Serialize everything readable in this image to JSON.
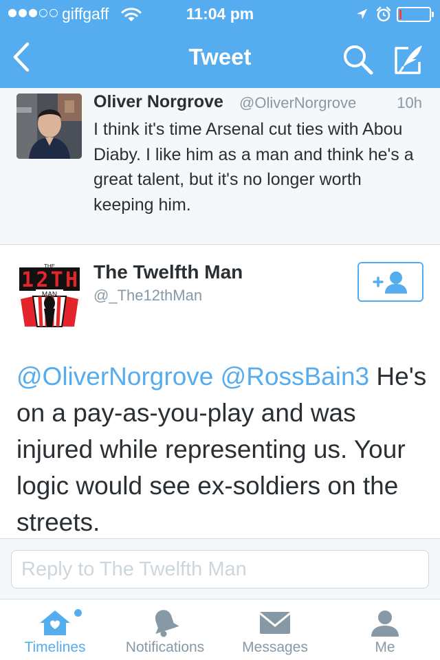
{
  "status_bar": {
    "carrier": "giffgaff",
    "signal_bars_filled": 3,
    "signal_bars_total": 5,
    "time": "11:04 pm",
    "battery_level_fraction": 0.08,
    "battery_color": "#ff3b30"
  },
  "nav": {
    "title": "Tweet",
    "back_icon": "chevron-left-icon",
    "search_icon": "search-icon",
    "compose_icon": "compose-quill-icon",
    "color": "#55acee"
  },
  "parent_tweet": {
    "name": "Oliver Norgrove",
    "handle": "@OliverNorgrove",
    "time": "10h",
    "text": "I think it's time Arsenal cut ties with Abou Diaby. I like him as a man and think he's a great talent, but it's no longer worth keeping him."
  },
  "main_tweet": {
    "name": "The Twelfth Man",
    "handle": "@_The12thMan",
    "mention1": "@OliverNorgrove",
    "mention2": "@RossBain3",
    "body": "He's on a pay-as-you-play and was injured while representing us. Your logic would see ex-soldiers on the streets.",
    "follow_icon": "add-user-icon",
    "avatar_text_top": "THE",
    "avatar_text_main": "12TH",
    "avatar_text_bottom": "MAN"
  },
  "reply": {
    "placeholder": "Reply to The Twelfth Man"
  },
  "tabs": [
    {
      "label": "Timelines",
      "icon": "home-icon",
      "active": true
    },
    {
      "label": "Notifications",
      "icon": "bell-icon",
      "active": false
    },
    {
      "label": "Messages",
      "icon": "envelope-icon",
      "active": false
    },
    {
      "label": "Me",
      "icon": "person-icon",
      "active": false
    }
  ]
}
